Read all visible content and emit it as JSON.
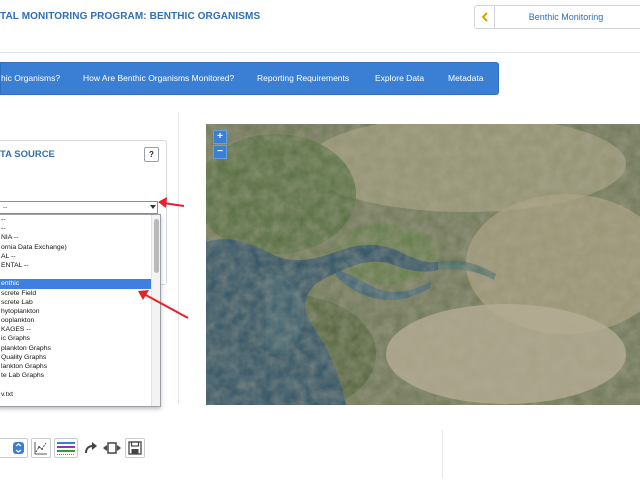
{
  "header": {
    "title": "TAL MONITORING PROGRAM: BENTHIC ORGANISMS",
    "breadcrumb_label": "Benthic Monitoring"
  },
  "nav": {
    "items": [
      {
        "label": "hic Organisms?"
      },
      {
        "label": "How Are Benthic Organisms Monitored?"
      },
      {
        "label": "Reporting Requirements"
      },
      {
        "label": "Explore Data"
      },
      {
        "label": "Metadata"
      }
    ]
  },
  "data_source": {
    "title": "TA SOURCE",
    "help_label": "?",
    "select_value": "--",
    "options": [
      {
        "label": "--",
        "selected": false
      },
      {
        "label": "--",
        "selected": false
      },
      {
        "label": "NIA --",
        "selected": false
      },
      {
        "label": "ornia Data Exchange)",
        "selected": false
      },
      {
        "label": "AL --",
        "selected": false
      },
      {
        "label": "ENTAL --",
        "selected": false
      },
      {
        "label": "",
        "selected": false
      },
      {
        "label": "enthic",
        "selected": true
      },
      {
        "label": "screte Field",
        "selected": false
      },
      {
        "label": "screte Lab",
        "selected": false
      },
      {
        "label": "hytoplankton",
        "selected": false
      },
      {
        "label": "ooplankton",
        "selected": false
      },
      {
        "label": "KAGES --",
        "selected": false
      },
      {
        "label": "ic Graphs",
        "selected": false
      },
      {
        "label": "plankton Graphs",
        "selected": false
      },
      {
        "label": "Quality Graphs",
        "selected": false
      },
      {
        "label": "lankton Graphs",
        "selected": false
      },
      {
        "label": "te Lab Graphs",
        "selected": false
      },
      {
        "label": "",
        "selected": false
      },
      {
        "label": "v.txt",
        "selected": false
      }
    ]
  },
  "map": {
    "zoom_in_label": "+",
    "zoom_out_label": "−"
  },
  "toolbar": {
    "icons": [
      "dropdown-icon",
      "chart-plot-icon",
      "legend-lines-icon",
      "redo-arrow-icon",
      "fit-width-icon",
      "save-disk-icon"
    ]
  },
  "colors": {
    "accent": "#3b7fd4",
    "title": "#2f6eb8",
    "selected": "#3f7fe0",
    "annotation_arrow": "#e8202a"
  }
}
